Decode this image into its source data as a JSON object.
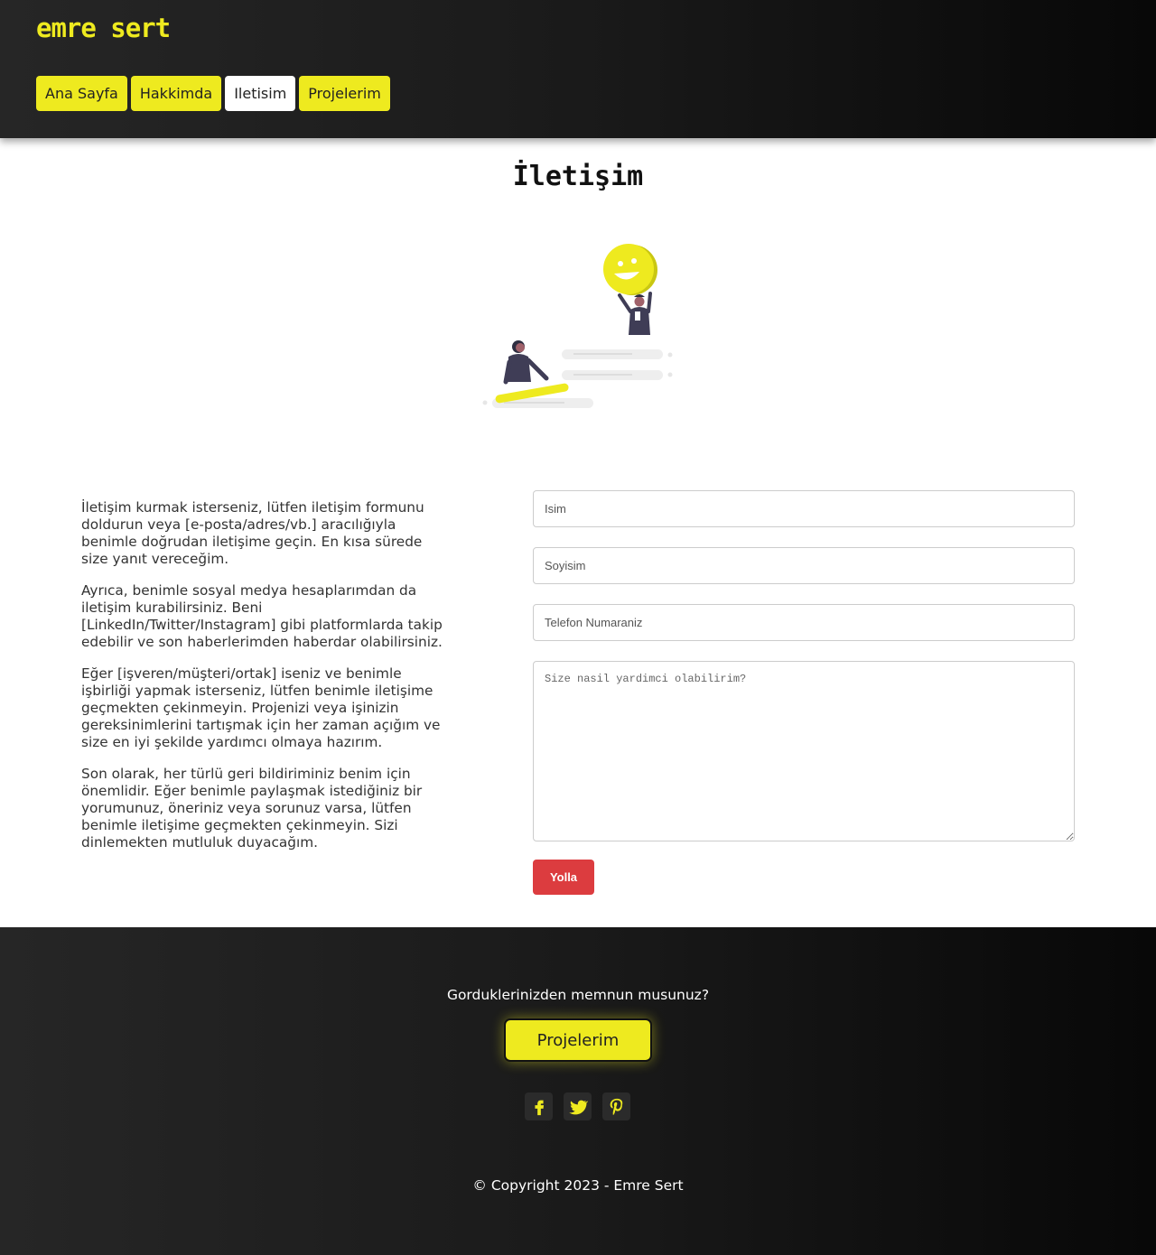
{
  "header": {
    "brand": "emre sert",
    "nav": [
      {
        "label": "Ana Sayfa",
        "active": false
      },
      {
        "label": "Hakkimda",
        "active": false
      },
      {
        "label": "Iletisim",
        "active": true
      },
      {
        "label": "Projelerim",
        "active": false
      }
    ]
  },
  "main": {
    "title": "İletişim",
    "illustration_icon": "contact-illustration-icon",
    "paragraphs": [
      "İletişim kurmak isterseniz, lütfen iletişim formunu doldurun veya [e-posta/adres/vb.] aracılığıyla benimle doğrudan iletişime geçin. En kısa sürede size yanıt vereceğim.",
      "Ayrıca, benimle sosyal medya hesaplarımdan da iletişim kurabilirsiniz. Beni [LinkedIn/Twitter/Instagram] gibi platformlarda takip edebilir ve son haberlerimden haberdar olabilirsiniz.",
      "Eğer [işveren/müşteri/ortak] iseniz ve benimle işbirliği yapmak isterseniz, lütfen benimle iletişime geçmekten çekinmeyin. Projenizi veya işinizin gereksinimlerini tartışmak için her zaman açığım ve size en iyi şekilde yardımcı olmaya hazırım.",
      "Son olarak, her türlü geri bildiriminiz benim için önemlidir. Eğer benimle paylaşmak istediğiniz bir yorumunuz, öneriniz veya sorunuz varsa, lütfen benimle iletişime geçmekten çekinmeyin. Sizi dinlemekten mutluluk duyacağım."
    ]
  },
  "form": {
    "name_placeholder": "Isim",
    "surname_placeholder": "Soyisim",
    "phone_placeholder": "Telefon Numaraniz",
    "message_placeholder": "Size nasil yardimci olabilirim?",
    "submit_label": "Yolla"
  },
  "footer": {
    "question": "Gorduklerinizden memnun musunuz?",
    "cta_label": "Projelerim",
    "socials": [
      "facebook-icon",
      "twitter-icon",
      "pinterest-icon"
    ],
    "copyright": "© Copyright 2023 - Emre Sert"
  },
  "colors": {
    "accent": "#eeea1f",
    "submit": "#dc3c3f",
    "dark": "#1a1a1a"
  }
}
